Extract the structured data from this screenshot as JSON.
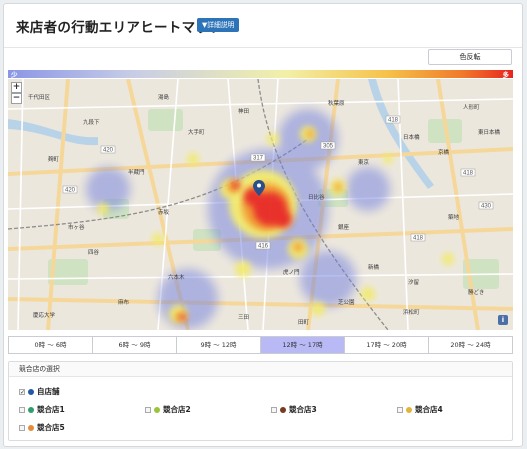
{
  "header": {
    "title": "来店者の行動エリアヒートマップ",
    "detail_button": "▼詳細説明"
  },
  "controls": {
    "invert_button": "色反転",
    "gradient_low": "少",
    "gradient_high": "多"
  },
  "map": {
    "zoom_in": "+",
    "zoom_out": "−",
    "info": "i",
    "road_labels": [
      {
        "name": "r420a",
        "text": "420"
      },
      {
        "name": "r420b",
        "text": "420"
      },
      {
        "name": "r317",
        "text": "317"
      },
      {
        "name": "r305",
        "text": "305"
      },
      {
        "name": "r418a",
        "text": "418"
      },
      {
        "name": "r418b",
        "text": "418"
      },
      {
        "name": "r418c",
        "text": "418"
      },
      {
        "name": "r416",
        "text": "416"
      },
      {
        "name": "r430",
        "text": "430"
      }
    ],
    "place_labels": [
      {
        "name": "place-chiyoda",
        "text": "千代田区"
      },
      {
        "name": "place-yushima",
        "text": "湯島"
      },
      {
        "name": "place-kanda",
        "text": "神田"
      },
      {
        "name": "place-akihabara",
        "text": "秋葉原"
      },
      {
        "name": "place-kudan",
        "text": "九段下"
      },
      {
        "name": "place-kojimachi",
        "text": "麹町"
      },
      {
        "name": "place-otemachi",
        "text": "大手町"
      },
      {
        "name": "place-tokyo",
        "text": "東京"
      },
      {
        "name": "place-ginza",
        "text": "銀座"
      },
      {
        "name": "place-nihonbashi",
        "text": "日本橋"
      },
      {
        "name": "place-hanzomon",
        "text": "半蔵門"
      },
      {
        "name": "place-hibiya",
        "text": "日比谷"
      },
      {
        "name": "place-kyobashi",
        "text": "京橋"
      },
      {
        "name": "place-tsukiji",
        "text": "築地"
      },
      {
        "name": "place-ningyocho",
        "text": "人形町"
      },
      {
        "name": "place-toyocho",
        "text": "東日本橋"
      },
      {
        "name": "place-kachidoki",
        "text": "勝どき"
      },
      {
        "name": "place-shimbashi",
        "text": "新橋"
      },
      {
        "name": "place-akasaka",
        "text": "赤坂"
      },
      {
        "name": "place-toranomon",
        "text": "虎ノ門"
      },
      {
        "name": "place-roppongi",
        "text": "六本木"
      },
      {
        "name": "place-hamamatsu",
        "text": "浜松町"
      },
      {
        "name": "place-shiodome",
        "text": "汐留"
      },
      {
        "name": "place-ichigaya",
        "text": "市ヶ谷"
      },
      {
        "name": "place-yotsuya",
        "text": "四谷"
      },
      {
        "name": "place-shibakoen",
        "text": "芝公園"
      },
      {
        "name": "place-mita",
        "text": "三田"
      },
      {
        "name": "place-azabu",
        "text": "麻布"
      },
      {
        "name": "place-tamachi",
        "text": "田町"
      },
      {
        "name": "place-keio",
        "text": "慶応大学"
      }
    ]
  },
  "time_tabs": [
    {
      "label": "0時 〜 6時",
      "active": false
    },
    {
      "label": "6時 〜 9時",
      "active": false
    },
    {
      "label": "9時 〜 12時",
      "active": false
    },
    {
      "label": "12時 〜 17時",
      "active": true
    },
    {
      "label": "17時 〜 20時",
      "active": false
    },
    {
      "label": "20時 〜 24時",
      "active": false
    }
  ],
  "competitors": {
    "heading": "競合店の選択",
    "own_store": {
      "label": "自店舗",
      "checked": true,
      "color": "#2457a6"
    },
    "items": [
      {
        "label": "競合店1",
        "color": "#2f9e6a"
      },
      {
        "label": "競合店2",
        "color": "#9bc43a"
      },
      {
        "label": "競合店3",
        "color": "#7a3a1e"
      },
      {
        "label": "競合店4",
        "color": "#e1b43a"
      },
      {
        "label": "競合店5",
        "color": "#e88a3a"
      }
    ]
  },
  "colors": {
    "accent": "#2c73b8",
    "active_tab": "#b9b9f5",
    "marker": "#2a4f8a"
  }
}
